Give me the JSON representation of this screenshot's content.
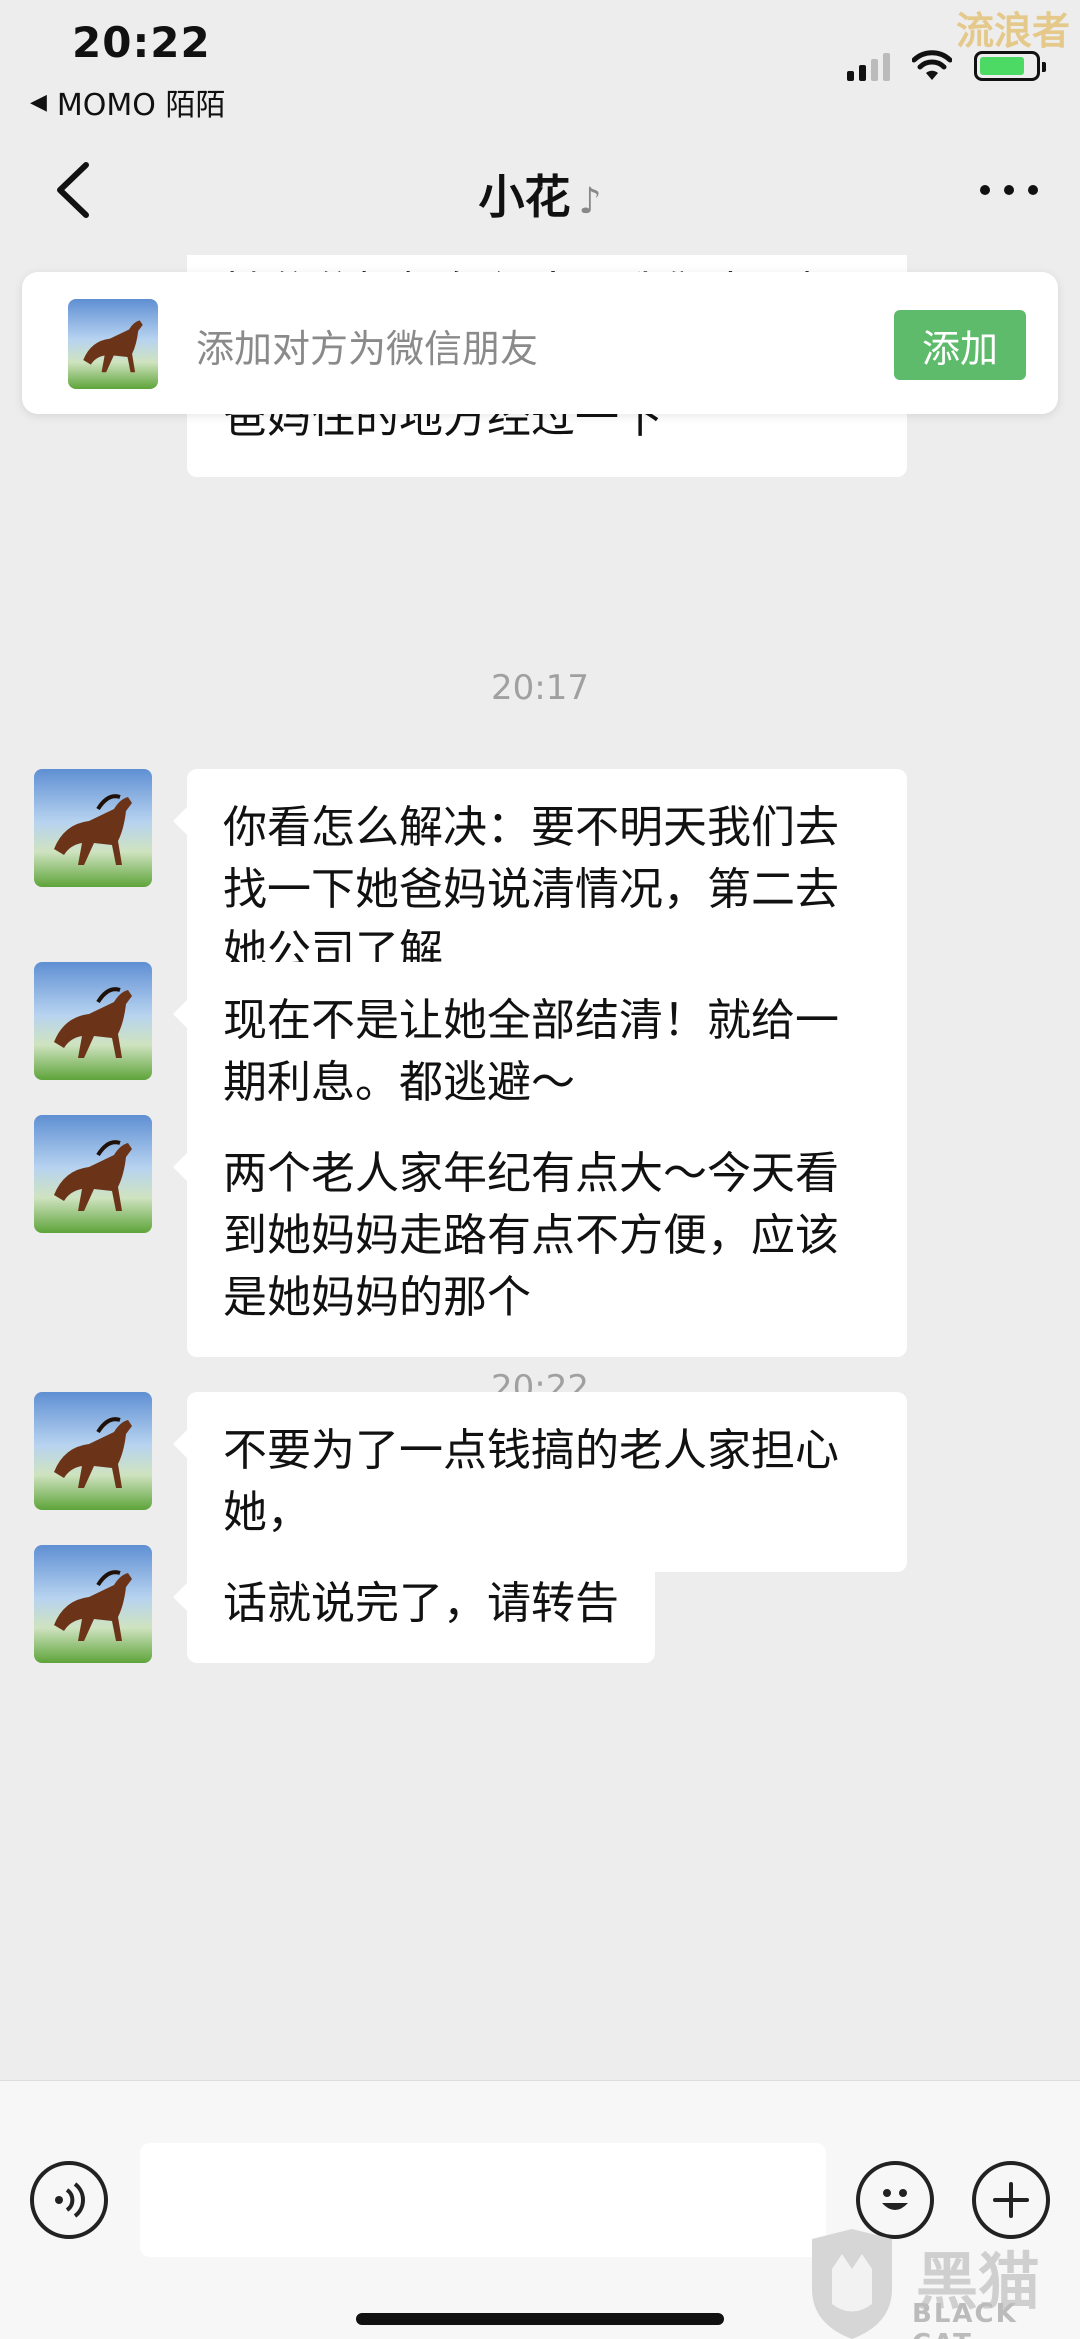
{
  "status_bar": {
    "time": "20:22",
    "back_app": "MOMO 陌陌",
    "watermark": "流浪者"
  },
  "nav": {
    "title": "小花"
  },
  "add_friend": {
    "prompt": "添加对方为微信朋友",
    "button": "添加"
  },
  "messages": [
    {
      "text": "她爸爸妈妈年纪大了我们也不想上他家。经过我们了解也经过她爸妈住的地方经过一下"
    },
    {
      "time": "20:17"
    },
    {
      "text": "你看怎么解决：要不明天我们去找一下她爸妈说清情况，第二去她公司了解"
    },
    {
      "text": "现在不是让她全部结清！就给一期利息。都逃避～"
    },
    {
      "text": "两个老人家年纪有点大～今天看到她妈妈走路有点不方便，应该是她妈妈的那个"
    },
    {
      "time": "20:22"
    },
    {
      "text": "不要为了一点钱搞的老人家担心她，"
    },
    {
      "text": "话就说完了，请转告"
    }
  ],
  "footer_watermark": {
    "cn": "黑猫",
    "en": "BLACK CAT"
  },
  "colors": {
    "background": "#ededed",
    "add_button": "#5dbb6b",
    "bubble": "#ffffff"
  }
}
